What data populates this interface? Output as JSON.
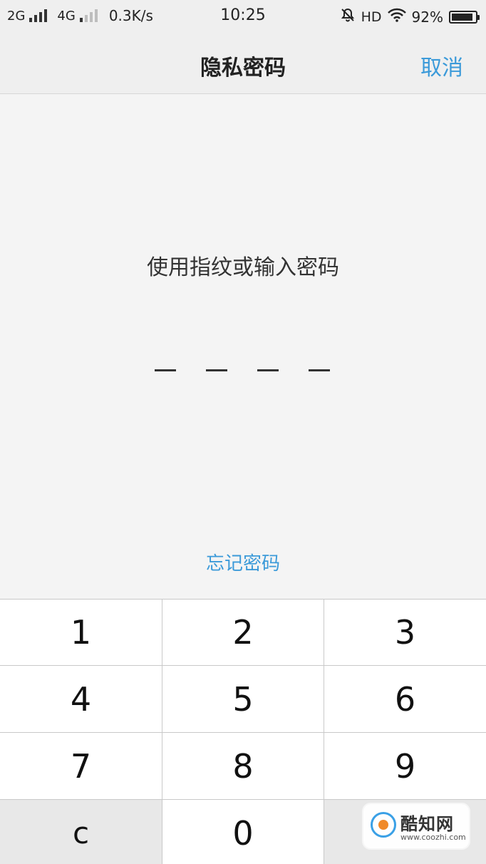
{
  "status_bar": {
    "network_1": "2G",
    "network_2": "4G",
    "speed": "0.3K/s",
    "time": "10:25",
    "hd": "HD",
    "battery_text": "92%",
    "battery_level": 0.92
  },
  "header": {
    "title": "隐私密码",
    "cancel_label": "取消"
  },
  "prompt": "使用指纹或输入密码",
  "pin_length": 4,
  "forgot_label": "忘记密码",
  "keypad": {
    "k1": "1",
    "k2": "2",
    "k3": "3",
    "k4": "4",
    "k5": "5",
    "k6": "6",
    "k7": "7",
    "k8": "8",
    "k9": "9",
    "clear": "c",
    "k0": "0"
  },
  "watermark": {
    "name": "酷知网",
    "url": "www.coozhi.com"
  },
  "colors": {
    "accent": "#3b9ad9",
    "background": "#f4f4f4",
    "key_bg": "#ffffff",
    "fn_key_bg": "#e8e8e8"
  }
}
